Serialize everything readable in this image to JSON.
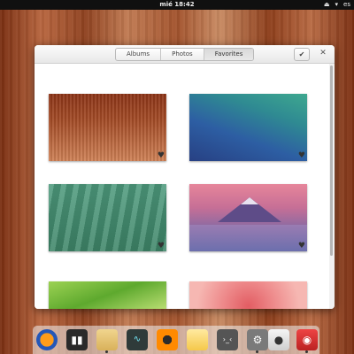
{
  "panel": {
    "clock": "mié 18:42",
    "indicators": [
      "⏏",
      "▾",
      "es"
    ]
  },
  "dialog": {
    "tabs": [
      {
        "label": "Albums",
        "active": false
      },
      {
        "label": "Photos",
        "active": false
      },
      {
        "label": "Favorites",
        "active": true
      }
    ],
    "ok_glyph": "✔",
    "close_glyph": "✕",
    "heart_glyph": "♥"
  },
  "wallpapers": [
    {
      "name": "wood",
      "favorite": true
    },
    {
      "name": "green-blue-wave",
      "favorite": true
    },
    {
      "name": "green-leaves",
      "favorite": true
    },
    {
      "name": "mountain-fuji",
      "favorite": true
    },
    {
      "name": "green-leaf",
      "favorite": true
    },
    {
      "name": "pink-flower",
      "favorite": true
    }
  ],
  "dock": {
    "items": [
      {
        "icon": "firefox-icon",
        "running": false
      },
      {
        "icon": "video-clapper-icon",
        "running": false
      },
      {
        "icon": "files-icon",
        "running": true
      },
      {
        "icon": "system-monitor-icon",
        "running": false
      },
      {
        "icon": "music-player-icon",
        "running": false
      },
      {
        "icon": "notes-icon",
        "running": false
      },
      {
        "icon": "terminal-icon",
        "running": false
      },
      {
        "icon": "settings-icon",
        "running": true
      },
      {
        "icon": "camera-icon",
        "running": false
      },
      {
        "icon": "photo-booth-icon",
        "running": true
      }
    ]
  },
  "colors": {
    "panel_bg": "#101010",
    "dialog_bg": "#f6f6f6"
  }
}
